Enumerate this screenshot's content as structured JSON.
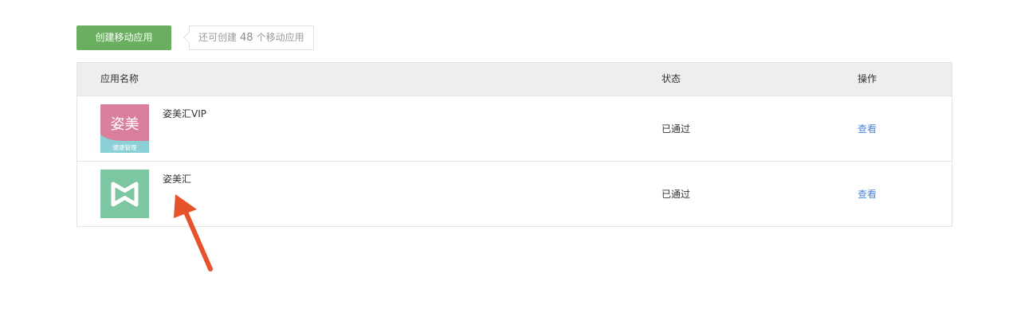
{
  "toolbar": {
    "create_label": "创建移动应用",
    "quota_prefix": "还可创建",
    "quota_count": "48",
    "quota_suffix": "个移动应用"
  },
  "table": {
    "headers": {
      "name": "应用名称",
      "status": "状态",
      "action": "操作"
    },
    "rows": [
      {
        "name": "姿美汇VIP",
        "icon": "zimei-vip-app-icon",
        "icon_text": "姿美",
        "icon_subtext": "健康管理",
        "status": "已通过",
        "action": "查看"
      },
      {
        "name": "姿美汇",
        "icon": "zimei-app-icon",
        "status": "已通过",
        "action": "查看"
      }
    ]
  },
  "colors": {
    "primary_green": "#6aaf5f",
    "link_blue": "#4a86d6",
    "header_bg": "#eceef0",
    "vip_icon_pink": "#d97f9c",
    "vip_icon_teal": "#8ad0d6",
    "app_icon_green": "#7cc6a2",
    "annotation_arrow": "#e5532a"
  }
}
